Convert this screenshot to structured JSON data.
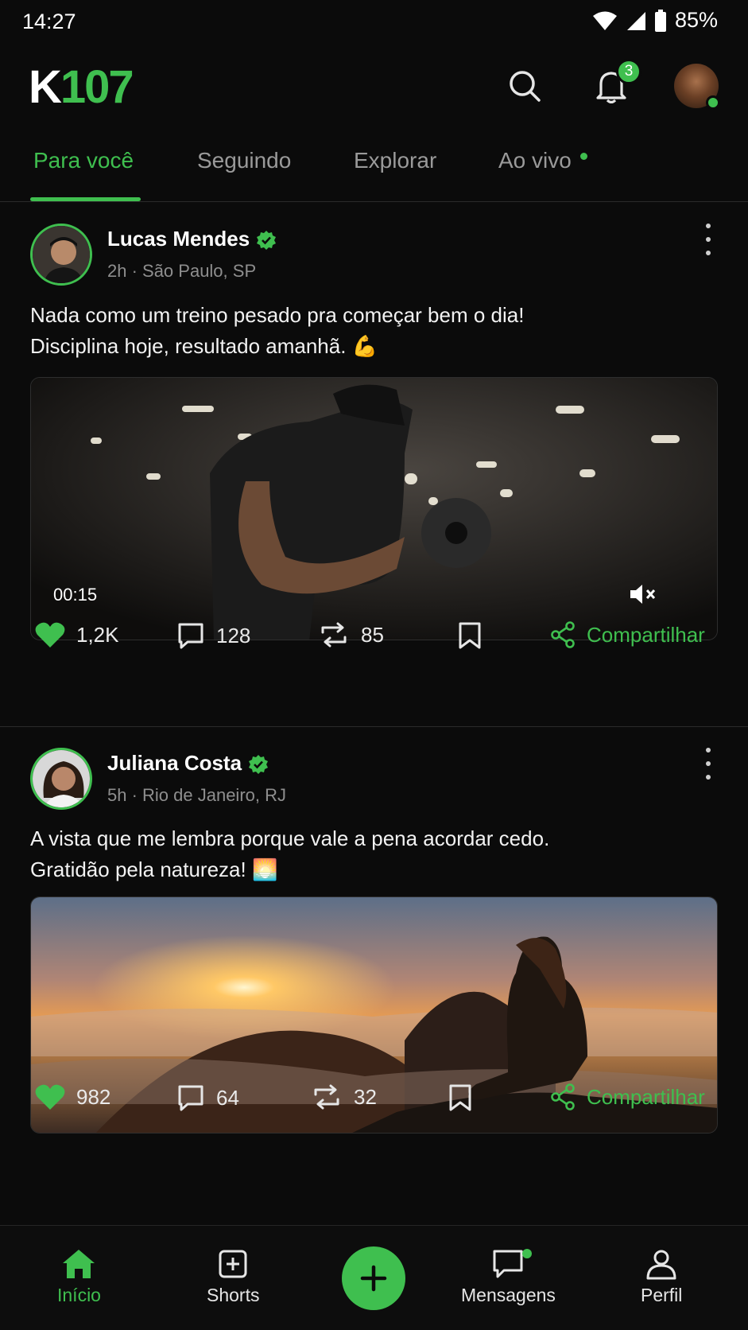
{
  "status_bar": {
    "time": "14:27",
    "battery": "85%"
  },
  "header": {
    "logo_k": "K",
    "logo_num": "107",
    "notification_count": "3"
  },
  "tabs": [
    {
      "label": "Para você",
      "active": true
    },
    {
      "label": "Seguindo"
    },
    {
      "label": "Explorar"
    },
    {
      "label": "Ao vivo",
      "live_indicator": true
    }
  ],
  "posts": [
    {
      "author": "Lucas Mendes",
      "verified": true,
      "meta": "2h · São Paulo, SP",
      "text_line1": "Nada como um treino pesado pra começar bem o dia!",
      "text_line2": "Disciplina hoje, resultado amanhã. 💪",
      "media_type": "video",
      "duration": "00:15",
      "likes": "1,2K",
      "comments": "128",
      "reposts": "85",
      "share_label": "Compartilhar"
    },
    {
      "author": "Juliana Costa",
      "verified": true,
      "meta": "5h · Rio de Janeiro, RJ",
      "text_line1": "A vista que me lembra porque vale a pena acordar cedo.",
      "text_line2": "Gratidão pela natureza! 🌅",
      "media_type": "image",
      "likes": "982",
      "comments": "64",
      "reposts": "32",
      "share_label": "Compartilhar"
    }
  ],
  "bottom_nav": [
    {
      "label": "Início",
      "icon": "home-icon",
      "active": true
    },
    {
      "label": "Shorts",
      "icon": "shorts-icon"
    },
    {
      "label": "",
      "icon": "plus-icon"
    },
    {
      "label": "Mensagens",
      "icon": "chat-icon"
    },
    {
      "label": "Perfil",
      "icon": "profile-icon"
    }
  ],
  "colors": {
    "accent": "#3fbf4f",
    "background": "#0b0b0b",
    "muted": "#8e8e8e"
  }
}
